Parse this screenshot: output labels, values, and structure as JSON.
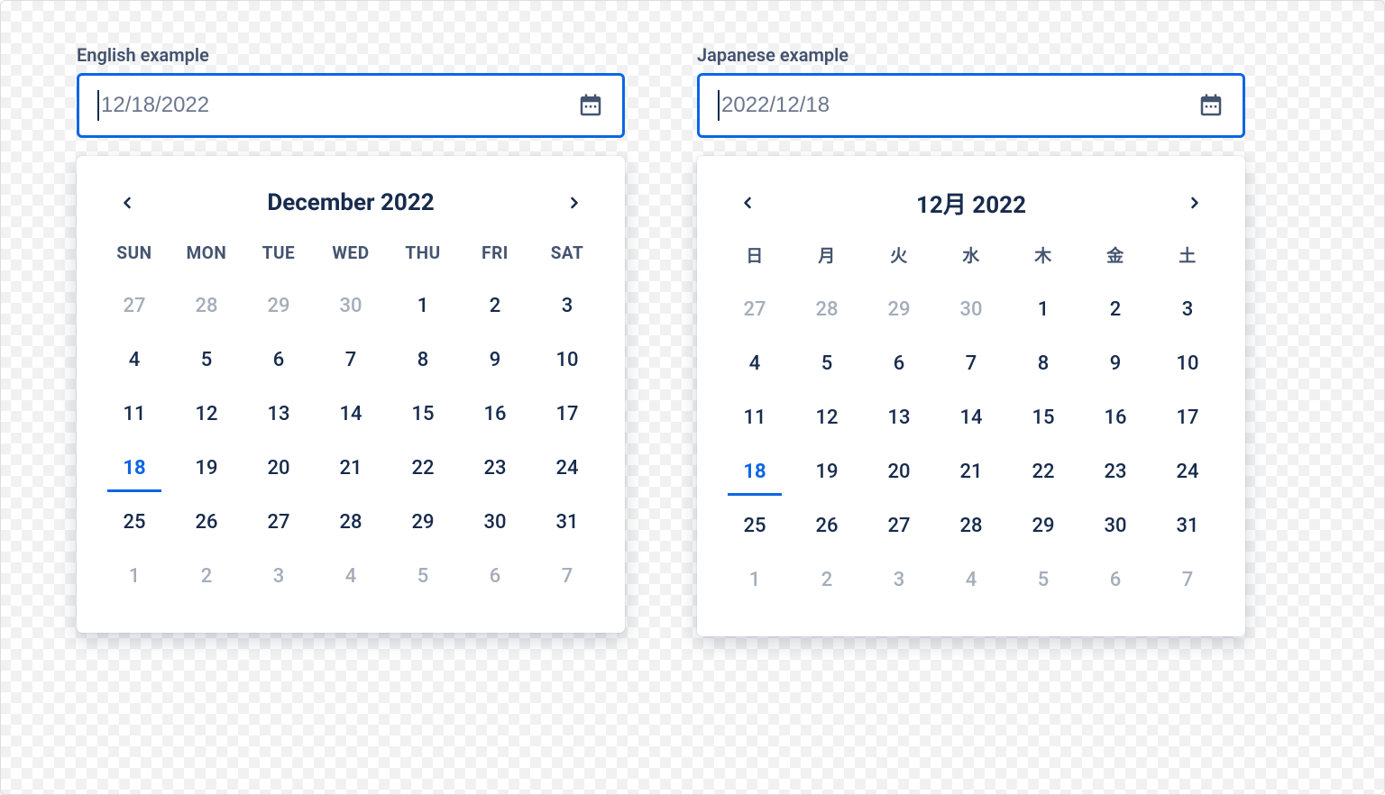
{
  "examples": [
    {
      "id": "en",
      "label": "English example",
      "input_value": "12/18/2022",
      "month_title": "December 2022",
      "weekday_headers": [
        "SUN",
        "MON",
        "TUE",
        "WED",
        "THU",
        "FRI",
        "SAT"
      ],
      "days": [
        {
          "n": 27,
          "muted": true
        },
        {
          "n": 28,
          "muted": true
        },
        {
          "n": 29,
          "muted": true
        },
        {
          "n": 30,
          "muted": true
        },
        {
          "n": 1
        },
        {
          "n": 2
        },
        {
          "n": 3
        },
        {
          "n": 4
        },
        {
          "n": 5
        },
        {
          "n": 6
        },
        {
          "n": 7
        },
        {
          "n": 8
        },
        {
          "n": 9
        },
        {
          "n": 10
        },
        {
          "n": 11
        },
        {
          "n": 12
        },
        {
          "n": 13
        },
        {
          "n": 14
        },
        {
          "n": 15
        },
        {
          "n": 16
        },
        {
          "n": 17
        },
        {
          "n": 18,
          "selected": true
        },
        {
          "n": 19
        },
        {
          "n": 20
        },
        {
          "n": 21
        },
        {
          "n": 22
        },
        {
          "n": 23
        },
        {
          "n": 24
        },
        {
          "n": 25
        },
        {
          "n": 26
        },
        {
          "n": 27
        },
        {
          "n": 28
        },
        {
          "n": 29
        },
        {
          "n": 30
        },
        {
          "n": 31
        },
        {
          "n": 1,
          "muted": true
        },
        {
          "n": 2,
          "muted": true
        },
        {
          "n": 3,
          "muted": true
        },
        {
          "n": 4,
          "muted": true
        },
        {
          "n": 5,
          "muted": true
        },
        {
          "n": 6,
          "muted": true
        },
        {
          "n": 7,
          "muted": true
        }
      ]
    },
    {
      "id": "ja",
      "label": "Japanese example",
      "input_value": "2022/12/18",
      "month_title": "12月 2022",
      "weekday_headers": [
        "日",
        "月",
        "火",
        "水",
        "木",
        "金",
        "土"
      ],
      "days": [
        {
          "n": 27,
          "muted": true
        },
        {
          "n": 28,
          "muted": true
        },
        {
          "n": 29,
          "muted": true
        },
        {
          "n": 30,
          "muted": true
        },
        {
          "n": 1
        },
        {
          "n": 2
        },
        {
          "n": 3
        },
        {
          "n": 4
        },
        {
          "n": 5
        },
        {
          "n": 6
        },
        {
          "n": 7
        },
        {
          "n": 8
        },
        {
          "n": 9
        },
        {
          "n": 10
        },
        {
          "n": 11
        },
        {
          "n": 12
        },
        {
          "n": 13
        },
        {
          "n": 14
        },
        {
          "n": 15
        },
        {
          "n": 16
        },
        {
          "n": 17
        },
        {
          "n": 18,
          "selected": true
        },
        {
          "n": 19
        },
        {
          "n": 20
        },
        {
          "n": 21
        },
        {
          "n": 22
        },
        {
          "n": 23
        },
        {
          "n": 24
        },
        {
          "n": 25
        },
        {
          "n": 26
        },
        {
          "n": 27
        },
        {
          "n": 28
        },
        {
          "n": 29
        },
        {
          "n": 30
        },
        {
          "n": 31
        },
        {
          "n": 1,
          "muted": true
        },
        {
          "n": 2,
          "muted": true
        },
        {
          "n": 3,
          "muted": true
        },
        {
          "n": 4,
          "muted": true
        },
        {
          "n": 5,
          "muted": true
        },
        {
          "n": 6,
          "muted": true
        },
        {
          "n": 7,
          "muted": true
        }
      ]
    }
  ]
}
